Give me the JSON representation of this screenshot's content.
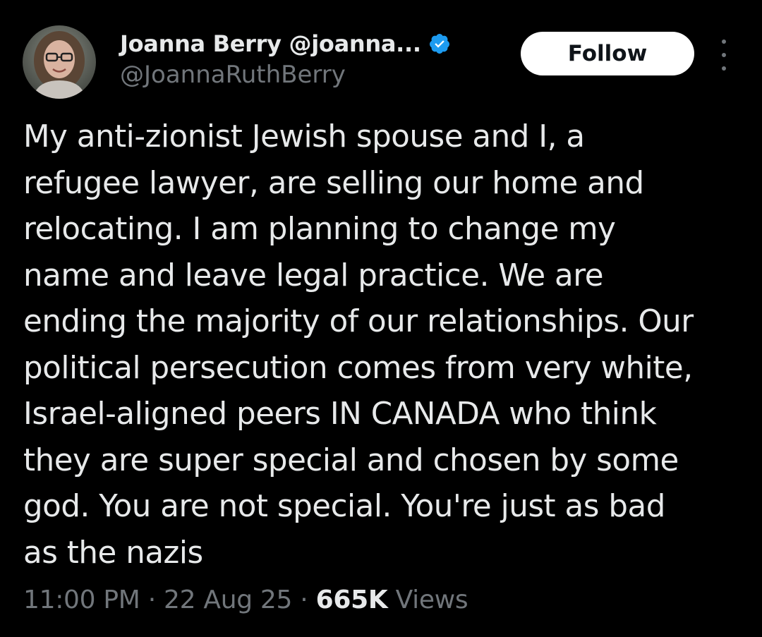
{
  "author": {
    "display_name": "Joanna Berry @joanna...",
    "handle": "@JoannaRuthBerry",
    "verified": true,
    "verified_color": "#1d9bf0"
  },
  "actions": {
    "follow_label": "Follow",
    "more_icon": "more-vertical-icon"
  },
  "tweet": {
    "lines": [
      "My anti-zionist Jewish spouse and I, a",
      "refugee lawyer, are selling our home and",
      "relocating. I am planning to change my",
      "name and leave legal practice. We are",
      "ending the majority of our relationships. Our",
      "political persecution comes from very white,",
      "Israel-aligned peers IN CANADA who think",
      "they are super special and chosen by some",
      "god. You are not special. You're just as bad",
      "as the nazis"
    ]
  },
  "meta": {
    "time": "11:00 PM",
    "separator": "·",
    "date": "22 Aug 25",
    "views_count": "665K",
    "views_label": "Views"
  },
  "colors": {
    "background": "#000000",
    "primary_text": "#e7e9ea",
    "secondary_text": "#71767b",
    "button_bg": "#ffffff"
  }
}
